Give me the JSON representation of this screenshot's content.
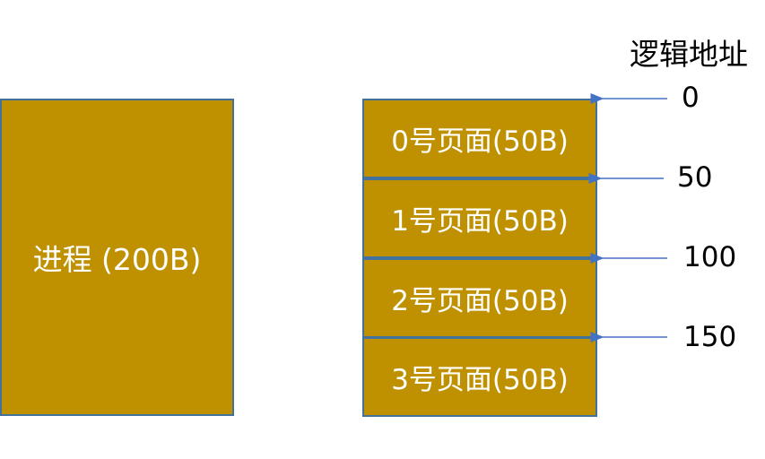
{
  "process": {
    "label": "进程 (200B)"
  },
  "pages": [
    {
      "label": "0号页面(50B)"
    },
    {
      "label": "1号页面(50B)"
    },
    {
      "label": "2号页面(50B)"
    },
    {
      "label": "3号页面(50B)"
    }
  ],
  "logical_address": {
    "title": "逻辑地址",
    "marks": [
      "0",
      "50",
      "100",
      "150"
    ]
  },
  "colors": {
    "box_fill": "#BF9000",
    "box_border": "#41719C",
    "arrow": "#4472C4"
  }
}
